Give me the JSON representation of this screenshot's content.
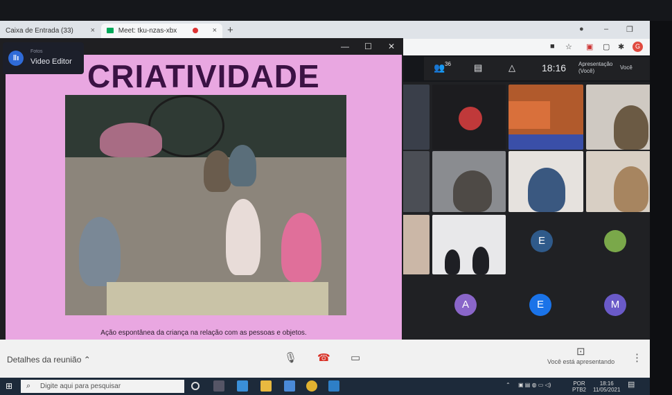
{
  "browser": {
    "tabs": [
      {
        "label": "Caixa de Entrada (33)",
        "close": "×"
      },
      {
        "label": "Meet: tku-nzas-xbx",
        "close": "×"
      }
    ],
    "new_tab": "+",
    "profile_initial": "G",
    "window_controls": [
      "–",
      "❐",
      "✕"
    ]
  },
  "meet": {
    "participant_count": "36",
    "time": "18:16",
    "presenting_label": "Apresentação",
    "presenting_sub": "(Você)",
    "you_label": "Você",
    "tiles": [
      {
        "letter": "E",
        "color": "#2f5a8a"
      },
      {
        "letter": "A",
        "color": "#8a66c9"
      },
      {
        "letter": "E",
        "color": "#1a73e8"
      },
      {
        "letter": "M",
        "color": "#6a5ac8"
      }
    ],
    "bottom": {
      "details": "Detalhes da reunião",
      "presenting_status": "Você está apresentando"
    }
  },
  "presentation": {
    "app_small": "Fotos",
    "app_name": "Video Editor",
    "window_controls": [
      "—",
      "☐",
      "✕"
    ],
    "title": "CRIATIVIDADE",
    "caption": "Ação espontânea da criança na relação com as pessoas e objetos."
  },
  "taskbar": {
    "search_placeholder": "Digite aqui para pesquisar",
    "lang": "POR",
    "lang_sub": "PTB2",
    "time": "18:16",
    "date": "11/05/2021"
  }
}
